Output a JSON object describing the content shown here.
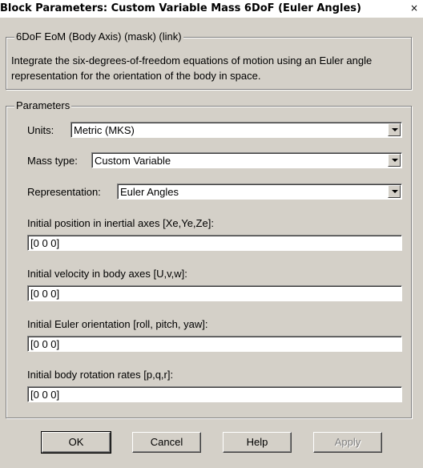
{
  "window": {
    "title": "Block Parameters: Custom Variable Mass 6DoF (Euler Angles)",
    "close_label": "×"
  },
  "mask": {
    "legend": "6DoF EoM (Body Axis) (mask) (link)",
    "description": "Integrate the six-degrees-of-freedom equations of motion using an Euler angle representation for the orientation of the body in space."
  },
  "parameters": {
    "legend": "Parameters",
    "units": {
      "label": "Units:",
      "value": "Metric (MKS)"
    },
    "mass_type": {
      "label": "Mass type:",
      "value": "Custom Variable"
    },
    "representation": {
      "label": "Representation:",
      "value": "Euler Angles"
    },
    "initial_position": {
      "label": "Initial position in inertial axes [Xe,Ye,Ze]:",
      "value": "[0 0 0]"
    },
    "initial_velocity": {
      "label": "Initial velocity in body axes [U,v,w]:",
      "value": "[0 0 0]"
    },
    "initial_euler": {
      "label": "Initial Euler orientation [roll, pitch, yaw]:",
      "value": "[0 0 0]"
    },
    "initial_rates": {
      "label": "Initial body rotation rates [p,q,r]:",
      "value": "[0 0 0]"
    }
  },
  "buttons": {
    "ok": "OK",
    "cancel": "Cancel",
    "help": "Help",
    "apply": "Apply"
  }
}
